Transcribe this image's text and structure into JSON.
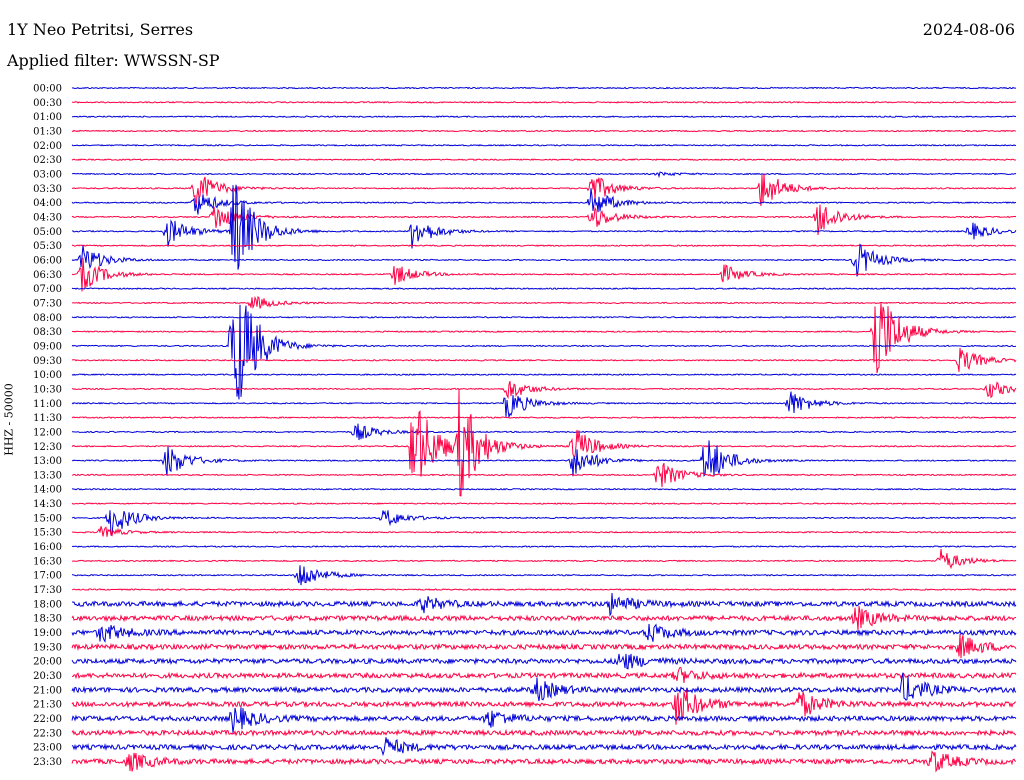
{
  "header": {
    "station": "1Y Neo Petritsi, Serres",
    "date": "2024-08-06",
    "filter": "Applied filter: WWSSN-SP"
  },
  "chart_data": {
    "type": "line",
    "title": "1Y Neo Petritsi, Serres",
    "subtitle": "Applied filter: WWSSN-SP",
    "ylabel": "HHZ - 50000",
    "row_labels": [
      "00:00",
      "00:30",
      "01:00",
      "01:30",
      "02:00",
      "02:30",
      "03:00",
      "03:30",
      "04:00",
      "04:30",
      "05:00",
      "05:30",
      "06:00",
      "06:30",
      "07:00",
      "07:30",
      "08:00",
      "08:30",
      "09:00",
      "09:30",
      "10:00",
      "10:30",
      "11:00",
      "11:30",
      "12:00",
      "12:30",
      "13:00",
      "13:30",
      "14:00",
      "14:30",
      "15:00",
      "15:30",
      "16:00",
      "16:30",
      "17:00",
      "17:30",
      "18:00",
      "18:30",
      "19:00",
      "19:30",
      "20:00",
      "20:30",
      "21:00",
      "21:30",
      "22:00",
      "22:30",
      "23:00",
      "23:30"
    ],
    "row_colors": [
      "#0000d8",
      "#ff0044"
    ],
    "noise_level": [
      1,
      1,
      1,
      1,
      1,
      1,
      1,
      1,
      1,
      1,
      1,
      1,
      1,
      1,
      1,
      1,
      1,
      1,
      1,
      1,
      1,
      1,
      1,
      1,
      1,
      1,
      1,
      1,
      1,
      1,
      1,
      1,
      1,
      1,
      1,
      1,
      4,
      4,
      4,
      4,
      4,
      4,
      4,
      4,
      4,
      4,
      4,
      4
    ],
    "events": [
      {
        "row": 6,
        "pos": 0.62,
        "amp": 2
      },
      {
        "row": 7,
        "pos": 0.13,
        "amp": 20
      },
      {
        "row": 7,
        "pos": 0.55,
        "amp": 16
      },
      {
        "row": 7,
        "pos": 0.73,
        "amp": 22
      },
      {
        "row": 8,
        "pos": 0.13,
        "amp": 14
      },
      {
        "row": 8,
        "pos": 0.55,
        "amp": 16
      },
      {
        "row": 9,
        "pos": 0.15,
        "amp": 16
      },
      {
        "row": 9,
        "pos": 0.55,
        "amp": 14
      },
      {
        "row": 9,
        "pos": 0.79,
        "amp": 20
      },
      {
        "row": 10,
        "pos": 0.1,
        "amp": 16
      },
      {
        "row": 10,
        "pos": 0.36,
        "amp": 18
      },
      {
        "row": 10,
        "pos": 0.95,
        "amp": 10
      },
      {
        "row": 10,
        "pos": 0.17,
        "amp": 60
      },
      {
        "row": 12,
        "pos": 0.01,
        "amp": 16
      },
      {
        "row": 12,
        "pos": 0.83,
        "amp": 20
      },
      {
        "row": 13,
        "pos": 0.01,
        "amp": 18
      },
      {
        "row": 13,
        "pos": 0.34,
        "amp": 12
      },
      {
        "row": 13,
        "pos": 0.69,
        "amp": 10
      },
      {
        "row": 15,
        "pos": 0.19,
        "amp": 8
      },
      {
        "row": 17,
        "pos": 0.85,
        "amp": 60
      },
      {
        "row": 18,
        "pos": 0.17,
        "amp": 90
      },
      {
        "row": 19,
        "pos": 0.94,
        "amp": 14
      },
      {
        "row": 21,
        "pos": 0.46,
        "amp": 12
      },
      {
        "row": 21,
        "pos": 0.97,
        "amp": 10
      },
      {
        "row": 22,
        "pos": 0.46,
        "amp": 16
      },
      {
        "row": 22,
        "pos": 0.76,
        "amp": 14
      },
      {
        "row": 24,
        "pos": 0.3,
        "amp": 10
      },
      {
        "row": 25,
        "pos": 0.36,
        "amp": 60
      },
      {
        "row": 25,
        "pos": 0.41,
        "amp": 55
      },
      {
        "row": 25,
        "pos": 0.53,
        "amp": 22
      },
      {
        "row": 26,
        "pos": 0.1,
        "amp": 18
      },
      {
        "row": 26,
        "pos": 0.53,
        "amp": 18
      },
      {
        "row": 26,
        "pos": 0.67,
        "amp": 30
      },
      {
        "row": 27,
        "pos": 0.62,
        "amp": 16
      },
      {
        "row": 30,
        "pos": 0.04,
        "amp": 20
      },
      {
        "row": 30,
        "pos": 0.33,
        "amp": 10
      },
      {
        "row": 31,
        "pos": 0.03,
        "amp": 6
      },
      {
        "row": 33,
        "pos": 0.92,
        "amp": 12
      },
      {
        "row": 34,
        "pos": 0.24,
        "amp": 16
      },
      {
        "row": 36,
        "pos": 0.37,
        "amp": 8
      },
      {
        "row": 36,
        "pos": 0.57,
        "amp": 10
      },
      {
        "row": 37,
        "pos": 0.83,
        "amp": 12
      },
      {
        "row": 38,
        "pos": 0.03,
        "amp": 10
      },
      {
        "row": 38,
        "pos": 0.61,
        "amp": 10
      },
      {
        "row": 39,
        "pos": 0.94,
        "amp": 12
      },
      {
        "row": 40,
        "pos": 0.58,
        "amp": 10
      },
      {
        "row": 41,
        "pos": 0.64,
        "amp": 8
      },
      {
        "row": 42,
        "pos": 0.49,
        "amp": 12
      },
      {
        "row": 42,
        "pos": 0.88,
        "amp": 16
      },
      {
        "row": 43,
        "pos": 0.64,
        "amp": 22
      },
      {
        "row": 43,
        "pos": 0.77,
        "amp": 14
      },
      {
        "row": 44,
        "pos": 0.17,
        "amp": 14
      },
      {
        "row": 44,
        "pos": 0.44,
        "amp": 10
      },
      {
        "row": 46,
        "pos": 0.33,
        "amp": 10
      },
      {
        "row": 47,
        "pos": 0.06,
        "amp": 10
      },
      {
        "row": 47,
        "pos": 0.91,
        "amp": 12
      }
    ],
    "grid": false,
    "legend": "none"
  }
}
